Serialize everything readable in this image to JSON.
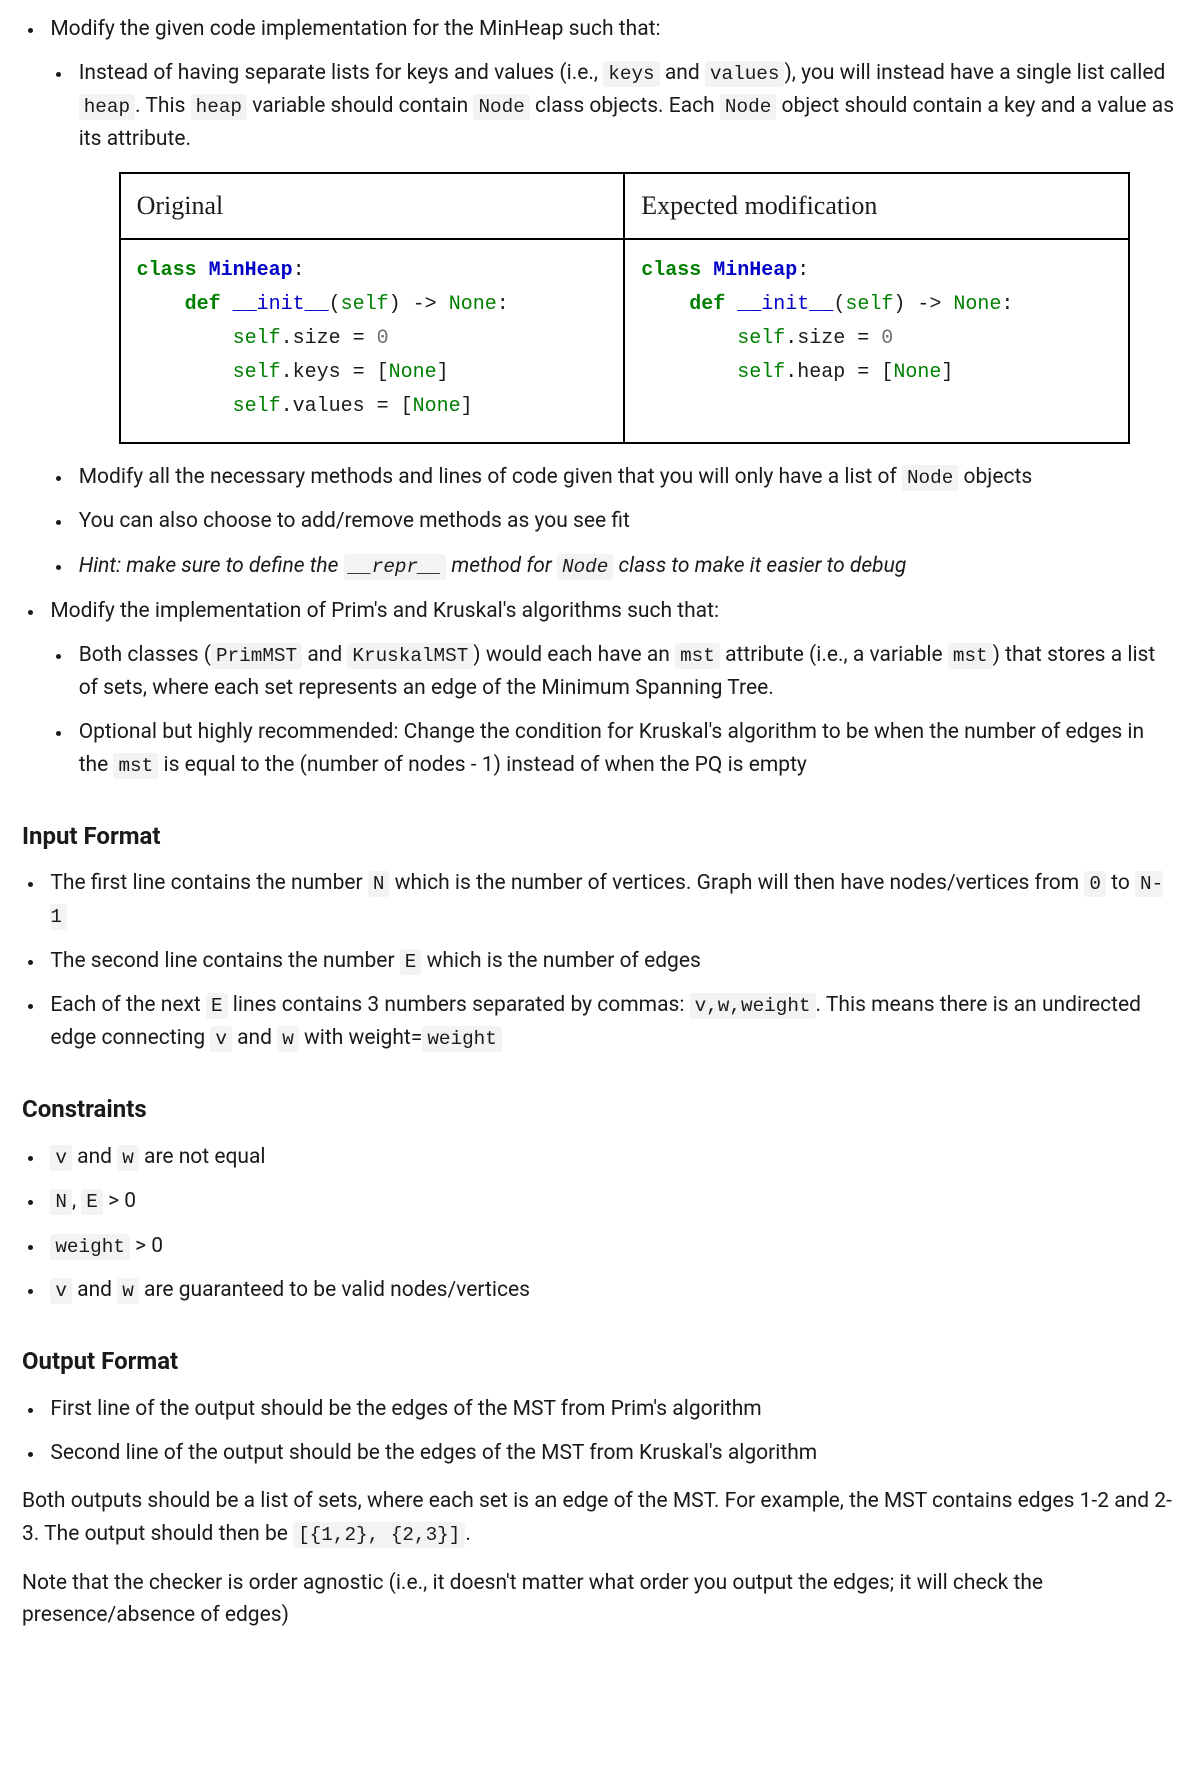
{
  "section1": {
    "bullet1_a": "Modify the given code implementation for the MinHeap such that:",
    "sub1_a": "Instead of having separate lists for keys and values (i.e., ",
    "code_keys": "keys",
    "sub1_b": " and ",
    "code_values": "values",
    "sub1_c": "), you will instead have a single list called ",
    "code_heap": "heap",
    "sub1_d": ". This ",
    "sub1_e": " variable should contain ",
    "code_node": "Node",
    "sub1_f": " class objects. Each ",
    "sub1_g": " object should contain a key and a value as its attribute.",
    "table_th1": "Original",
    "table_th2": "Expected modification",
    "sub2_a": "Modify all the necessary methods and lines of code given that you will only have a list of ",
    "sub2_b": " objects",
    "sub3": "You can also choose to add/remove methods as you see fit",
    "sub4_a": "Hint: make sure to define the ",
    "code_repr": "__repr__",
    "sub4_b": " method for ",
    "sub4_c": " class to make it easier to debug"
  },
  "section2": {
    "bullet1": "Modify the implementation of Prim's and Kruskal's algorithms such that:",
    "sub1_a": "Both classes (",
    "code_prim": "PrimMST",
    "sub1_b": " and ",
    "code_kruskal": "KruskalMST",
    "sub1_c": ") would each have an ",
    "code_mst": "mst",
    "sub1_d": " attribute (i.e., a variable ",
    "sub1_e": ") that stores a list of sets, where each set represents an edge of the Minimum Spanning Tree.",
    "sub2_a": "Optional but highly recommended: Change the condition for Kruskal's algorithm to be when the number of edges in the ",
    "sub2_b": " is equal to the (number of nodes - 1) instead of when the PQ is empty"
  },
  "input_format": {
    "heading": "Input Format",
    "b1_a": "The first line contains the number ",
    "code_N": "N",
    "b1_b": " which is the number of vertices. Graph will then have nodes/vertices from ",
    "code_0": "0",
    "b1_c": " to ",
    "code_N1": "N-1",
    "b2_a": "The second line contains the number ",
    "code_E": "E",
    "b2_b": " which is the number of edges",
    "b3_a": "Each of the next ",
    "b3_b": " lines contains 3 numbers separated by commas: ",
    "code_vww": "v,w,weight",
    "b3_c": ". This means there is an undirected edge connecting ",
    "code_v": "v",
    "b3_d": " and ",
    "code_w": "w",
    "b3_e": " with weight=",
    "code_weight": "weight"
  },
  "constraints": {
    "heading": "Constraints",
    "c1_b": " and ",
    "c1_d": " are not equal",
    "c2_a": "N",
    "c2_b": ", ",
    "c2_c": "E",
    "c2_d": " > 0",
    "c3_b": " > 0",
    "c4_b": " and ",
    "c4_d": " are guaranteed to be valid nodes/vertices"
  },
  "output_format": {
    "heading": "Output Format",
    "o1": "First line of the output should be the edges of the MST from Prim's algorithm",
    "o2": "Second line of the output should be the edges of the MST from Kruskal's algorithm",
    "p1_a": "Both outputs should be a list of sets, where each set is an edge of the MST. For example, the MST contains edges 1-2 and 2-3. The output should then be ",
    "code_example": "[{1,2}, {2,3}]",
    "p1_b": ".",
    "p2": "Note that the checker is order agnostic (i.e., it doesn't matter what order you output the edges; it will check the presence/absence of edges)"
  }
}
